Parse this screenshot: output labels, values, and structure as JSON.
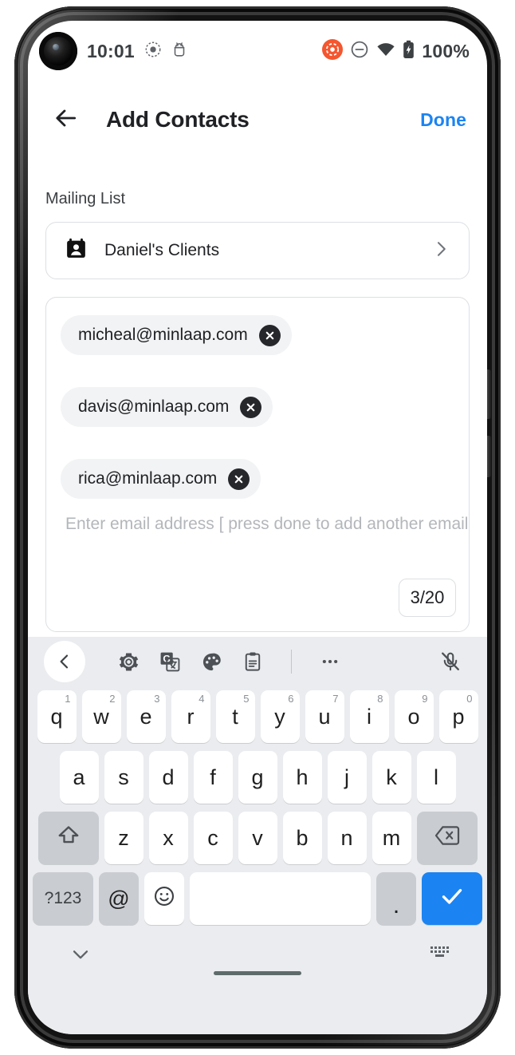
{
  "status_bar": {
    "clock": "10:01",
    "battery_percent": "100%",
    "icons": [
      "camera-punch-hole",
      "screen-record-dot-icon",
      "android-debug-icon",
      "screen-recording-active-icon",
      "do-not-disturb-icon",
      "wifi-icon",
      "battery-charging-icon"
    ]
  },
  "app_bar": {
    "back_icon": "arrow-left-icon",
    "title": "Add Contacts",
    "done_label": "Done"
  },
  "content": {
    "mailing_list_label": "Mailing List",
    "mailing_list": {
      "icon": "contacts-book-icon",
      "name": "Daniel's Clients",
      "chevron_icon": "chevron-right-icon"
    },
    "recipients": {
      "chips": [
        {
          "email": "micheal@minlaap.com",
          "remove_icon": "close-circle-icon"
        },
        {
          "email": "davis@minlaap.com",
          "remove_icon": "close-circle-icon"
        },
        {
          "email": "rica@minlaap.com",
          "remove_icon": "close-circle-icon"
        }
      ],
      "placeholder": "Enter email address [ press done to add another email ]",
      "counter": "3/20"
    }
  },
  "keyboard": {
    "toolbar": [
      {
        "name": "kb-collapse-toolbar-button",
        "icon": "chevron-left-icon"
      },
      {
        "name": "kb-settings-button",
        "icon": "gear-icon"
      },
      {
        "name": "kb-translate-button",
        "icon": "google-translate-icon"
      },
      {
        "name": "kb-theme-button",
        "icon": "palette-icon"
      },
      {
        "name": "kb-clipboard-button",
        "icon": "clipboard-icon"
      },
      {
        "name": "kb-more-button",
        "icon": "more-horizontal-icon"
      },
      {
        "name": "kb-mic-button",
        "icon": "mic-off-icon"
      }
    ],
    "row1": [
      {
        "key": "q",
        "sup": "1"
      },
      {
        "key": "w",
        "sup": "2"
      },
      {
        "key": "e",
        "sup": "3"
      },
      {
        "key": "r",
        "sup": "4"
      },
      {
        "key": "t",
        "sup": "5"
      },
      {
        "key": "y",
        "sup": "6"
      },
      {
        "key": "u",
        "sup": "7"
      },
      {
        "key": "i",
        "sup": "8"
      },
      {
        "key": "o",
        "sup": "9"
      },
      {
        "key": "p",
        "sup": "0"
      }
    ],
    "row2": [
      "a",
      "s",
      "d",
      "f",
      "g",
      "h",
      "j",
      "k",
      "l"
    ],
    "row3": {
      "shift_icon": "shift-arrow-icon",
      "letters": [
        "z",
        "x",
        "c",
        "v",
        "b",
        "n",
        "m"
      ],
      "backspace_icon": "backspace-icon"
    },
    "row4": {
      "symbols_label": "?123",
      "at_label": "@",
      "emoji_icon": "emoji-smiley-icon",
      "space_label": "",
      "period_label": ".",
      "enter_icon": "check-icon"
    },
    "bottom_bar": {
      "hide_icon": "chevron-down-icon",
      "switch_icon": "keyboard-switch-icon"
    }
  },
  "colors": {
    "accent_blue": "#1b84f2",
    "record_orange": "#f4562f",
    "key_white": "#ffffff",
    "key_gray": "#c9ccd1",
    "keyboard_bg": "#eaecef"
  }
}
